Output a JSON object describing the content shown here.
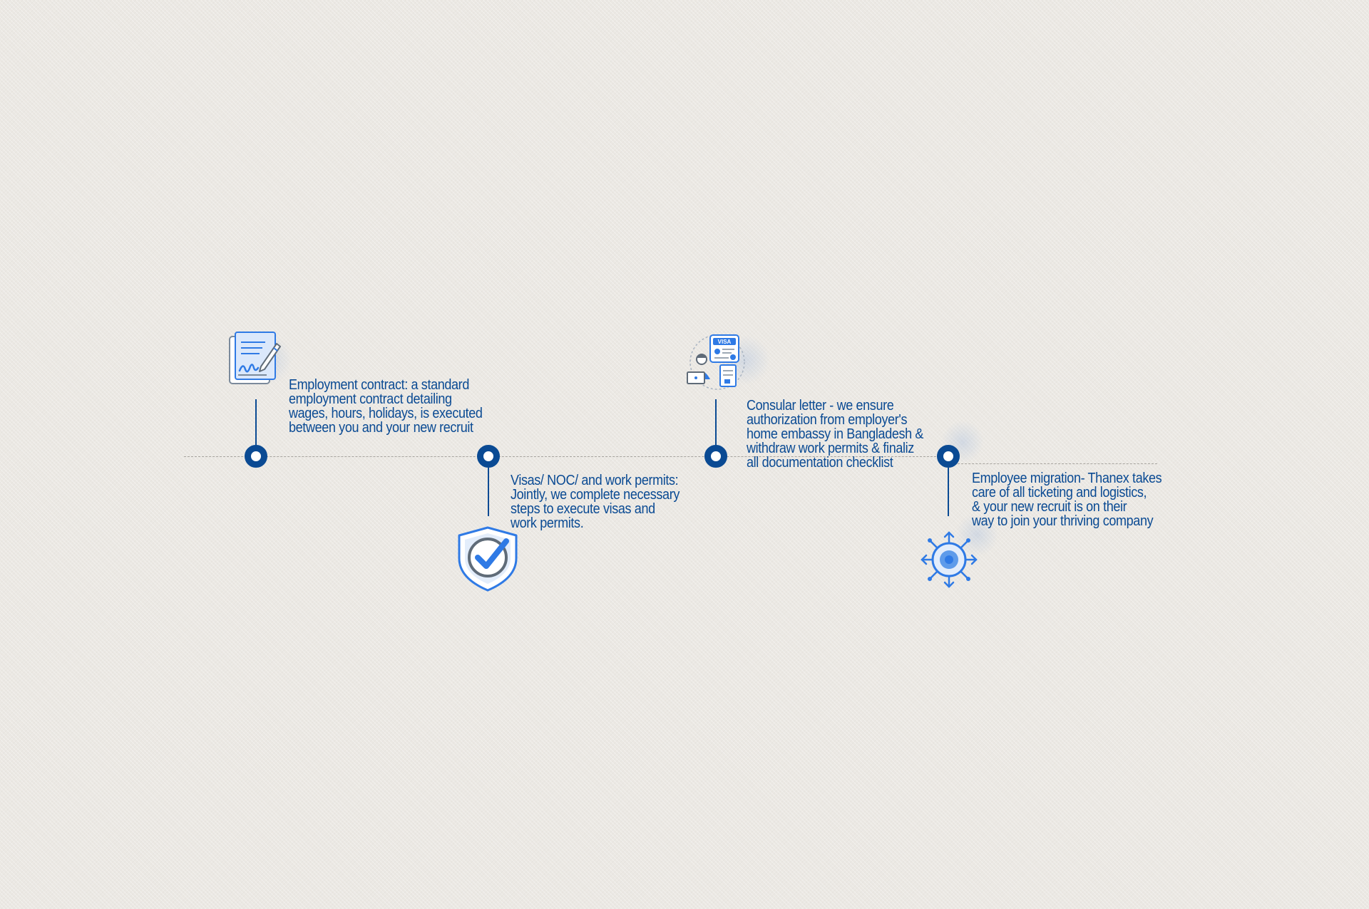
{
  "steps": [
    {
      "icon": "contract-signing-icon",
      "lines": [
        "Employment contract: a standard",
        "employment contract detailing",
        "wages, hours, holidays, is executed",
        "between you and your new recruit"
      ]
    },
    {
      "icon": "shield-check-icon",
      "lines": [
        "Visas/ NOC/ and work permits:",
        "Jointly, we complete necessary",
        "steps to execute visas and",
        "work permits."
      ]
    },
    {
      "icon": "visa-officer-icon",
      "visa_badge": "VISA",
      "lines": [
        "Consular letter - we ensure",
        "authorization from employer's",
        "home embassy in Bangladesh &",
        "withdraw work permits & finaliz",
        "all documentation checklist"
      ]
    },
    {
      "icon": "migration-hub-icon",
      "lines": [
        "Employee migration- Thanex takes",
        "care of all ticketing and logistics,",
        "& your new recruit is on their",
        "way to join your thriving company"
      ]
    }
  ],
  "colors": {
    "accent": "#0a4a93",
    "icon_blue": "#2f7ae5",
    "background": "#ebe8e3"
  }
}
